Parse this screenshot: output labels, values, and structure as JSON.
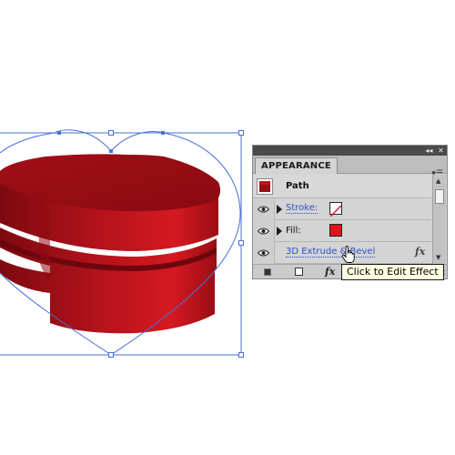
{
  "canvas": {
    "object": "heart-shaped 3D extruded red box",
    "selection_color": "#4a6fd8",
    "object_colors": [
      "#b1121c",
      "#d4171f",
      "#8a0a12"
    ]
  },
  "panel": {
    "tab_label": "APPEARANCE",
    "collapse_icon": "double-chevron-icon",
    "close_icon": "close-icon",
    "menu_icon": "panel-menu-icon",
    "object_row": {
      "label": "Path",
      "thumb_icon": "path-thumbnail-icon"
    },
    "stroke_row": {
      "label": "Stroke:",
      "swatch": "none",
      "swatch_icon": "no-color-icon"
    },
    "fill_row": {
      "label": "Fill:",
      "swatch_color": "#e0141b"
    },
    "effect_row": {
      "label": "3D Extrude & Bevel",
      "fx_icon": "fx-icon",
      "fx_text": "fx"
    },
    "footer": {
      "new_art_icon": "new-art-basic-icon",
      "clear_icon": "clear-appearance-icon",
      "fx_text": "fx",
      "fx_icon": "add-effect-icon"
    }
  },
  "tooltip": {
    "text": "Click to Edit Effect"
  },
  "cursor": {
    "icon": "hand-pointer-icon"
  }
}
